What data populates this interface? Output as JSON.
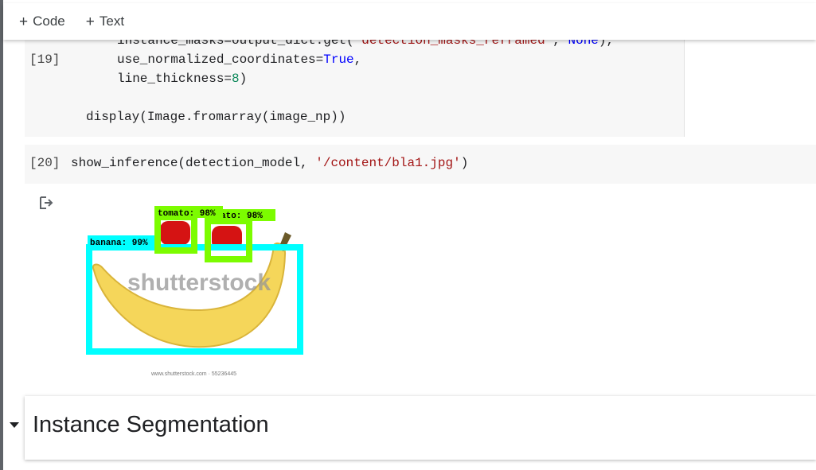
{
  "toolbar": {
    "code_label": "Code",
    "text_label": "Text",
    "add_icon": "plus-icon"
  },
  "cells": {
    "cell19": {
      "exec_count": "[19]",
      "line1": {
        "a": "instance_masks=output_dict.get(",
        "b": "'detection_masks_reframed'",
        "c": ", ",
        "d": "None",
        "e": "),"
      },
      "line2": {
        "a": "use_normalized_coordinates=",
        "b": "True",
        "c": ","
      },
      "line3": {
        "a": "line_thickness=",
        "b": "8",
        "c": ")"
      },
      "line4": "display(Image.fromarray(image_np))"
    },
    "cell20": {
      "exec_count": "[20]",
      "code": {
        "a": "show_inference(detection_model, ",
        "b": "'/content/bla1.jpg'",
        "c": ")"
      }
    }
  },
  "output": {
    "icon": "output-redirect-icon",
    "detections": [
      {
        "label": "tomato: 98%",
        "color": "#7cfc00"
      },
      {
        "label": "tomato: 98%",
        "color": "#7cfc00",
        "visible_text": "ato: 98%"
      },
      {
        "label": "banana: 99%",
        "color": "#00ffff"
      }
    ],
    "watermark": "shutterstock",
    "caption": "www.shutterstock.com · 55236445"
  },
  "heading": {
    "title": "Instance Segmentation",
    "toggle_icon": "caret-down-icon"
  }
}
